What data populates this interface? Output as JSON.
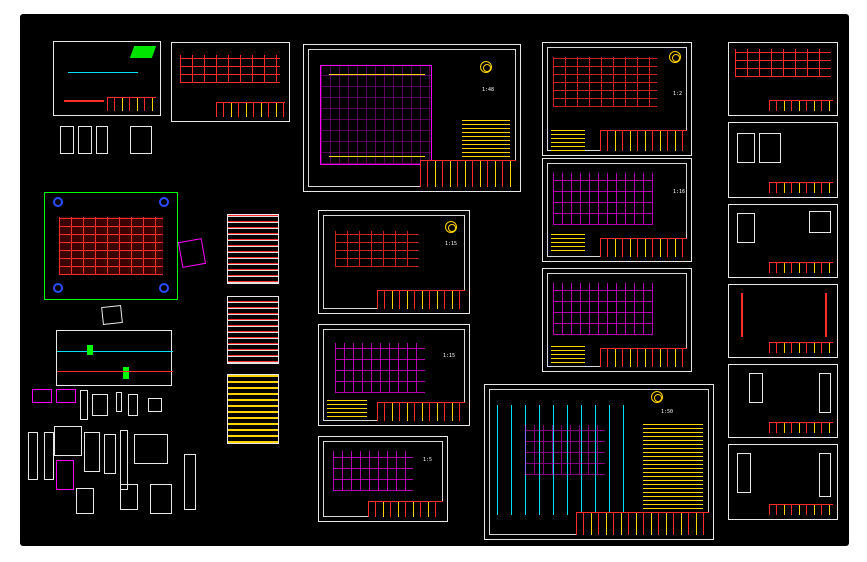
{
  "viewport": {
    "background": "#000000",
    "accent_colors": {
      "frame": "#e8e8e8",
      "red": "#ff2a2a",
      "magenta": "#ff00ff",
      "yellow": "#ffd400",
      "cyan": "#00e0ff",
      "green": "#00ff00",
      "blue": "#2a4bff"
    }
  },
  "labels": {
    "sheet_main_scale": "1:48",
    "sheet_a_scale": "1:15",
    "sheet_b_scale": "1:15",
    "sheet_c_scale": "1:5",
    "sheet_d_scale": "1:2",
    "sheet_e_scale": "1:16",
    "sheet_big_scale": "1:50"
  }
}
